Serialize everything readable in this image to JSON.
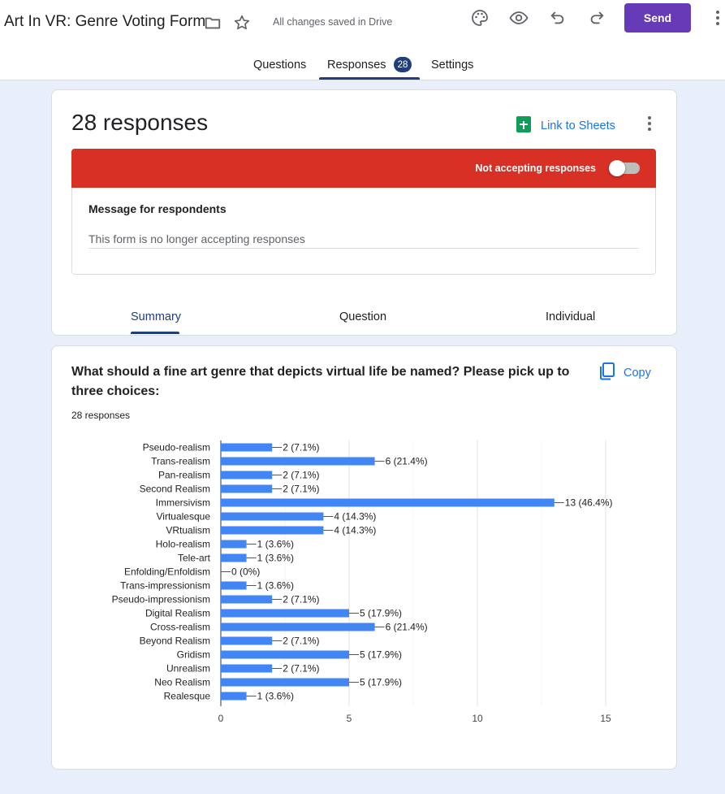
{
  "header": {
    "title": "Art In VR: Genre Voting Form",
    "saved_status": "All changes saved in Drive",
    "send_label": "Send"
  },
  "tabs": {
    "questions": "Questions",
    "responses": "Responses",
    "responses_badge": "28",
    "settings": "Settings"
  },
  "summary_card": {
    "responses_title": "28 responses",
    "link_to_sheets": "Link to Sheets",
    "not_accepting": "Not accepting responses",
    "message_label": "Message for respondents",
    "message_value": "This form is no longer accepting responses",
    "subtabs": {
      "summary": "Summary",
      "question": "Question",
      "individual": "Individual"
    }
  },
  "question_card": {
    "question": "What should a fine art genre that depicts virtual life be named? Please pick up to three choices:",
    "copy_label": "Copy",
    "response_count": "28 responses"
  },
  "colors": {
    "accent": "#673ab7",
    "bar": "#4285f4",
    "red_banner": "#d93025",
    "link": "#1a73e8"
  },
  "chart_data": {
    "type": "bar",
    "orientation": "horizontal",
    "categories": [
      "Pseudo-realism",
      "Trans-realism",
      "Pan-realism",
      "Second Realism",
      "Immersivism",
      "Virtualesque",
      "VRtualism",
      "Holo-realism",
      "Tele-art",
      "Enfolding/Enfoldism",
      "Trans-impressionism",
      "Pseudo-impressionism",
      "Digital Realism",
      "Cross-realism",
      "Beyond Realism",
      "Gridism",
      "Unrealism",
      "Neo Realism",
      "Realesque"
    ],
    "values": [
      2,
      6,
      2,
      2,
      13,
      4,
      4,
      1,
      1,
      0,
      1,
      2,
      5,
      6,
      2,
      5,
      2,
      5,
      1
    ],
    "data_labels": [
      "2 (7.1%)",
      "6 (21.4%)",
      "2 (7.1%)",
      "2 (7.1%)",
      "13 (46.4%)",
      "4 (14.3%)",
      "4 (14.3%)",
      "1 (3.6%)",
      "1 (3.6%)",
      "0 (0%)",
      "1 (3.6%)",
      "2 (7.1%)",
      "5 (17.9%)",
      "6 (21.4%)",
      "2 (7.1%)",
      "5 (17.9%)",
      "2 (7.1%)",
      "5 (17.9%)",
      "1 (3.6%)"
    ],
    "xticks": [
      "0",
      "5",
      "10",
      "15"
    ],
    "xlim": [
      0,
      15
    ],
    "grid": true
  }
}
